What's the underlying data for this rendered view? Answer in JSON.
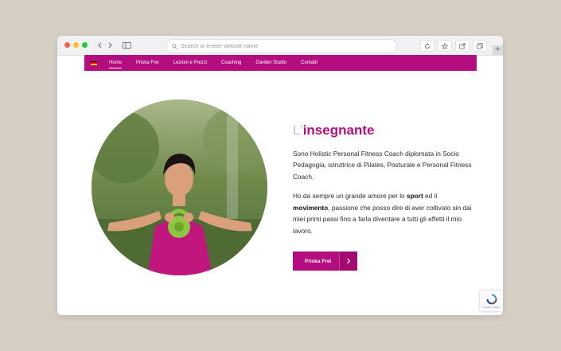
{
  "browser": {
    "address_placeholder": "Search or eneter website name",
    "new_tab_label": "+"
  },
  "nav": {
    "items": [
      {
        "label": "Home"
      },
      {
        "label": "Priska Frei"
      },
      {
        "label": "Lezioni e Prezzi"
      },
      {
        "label": "Coaching"
      },
      {
        "label": "Garden Studio"
      },
      {
        "label": "Contatti"
      }
    ],
    "active_index": 0,
    "flag_colors": [
      "#000000",
      "#dd0000",
      "#ffce00"
    ]
  },
  "colors": {
    "brand": "#b40d7f",
    "page_background": "#d6cfc6"
  },
  "section": {
    "heading_light": "L'",
    "heading_bold": "insegnante",
    "paragraph1": "Sono Holistic Personal Fitness Coach diplomata in Socio Pedagogia, istruttrice di Pilates, Posturale e Personal Fitness Coach.",
    "paragraph2": {
      "part1": "Ho da sempre un grande amore per lo ",
      "bold1": "sport",
      "part2": " ed il ",
      "bold2": "movimento",
      "part3": ", passione che posso dire di aver coltivato sin dai miei primi passi fino a farla diventare a tutti gli effetti il mio lavoro."
    },
    "cta_label": "Priska Frei",
    "cta_icon": "chevron-right-icon"
  },
  "recaptcha": {
    "footer": "Privacy - Terms"
  }
}
